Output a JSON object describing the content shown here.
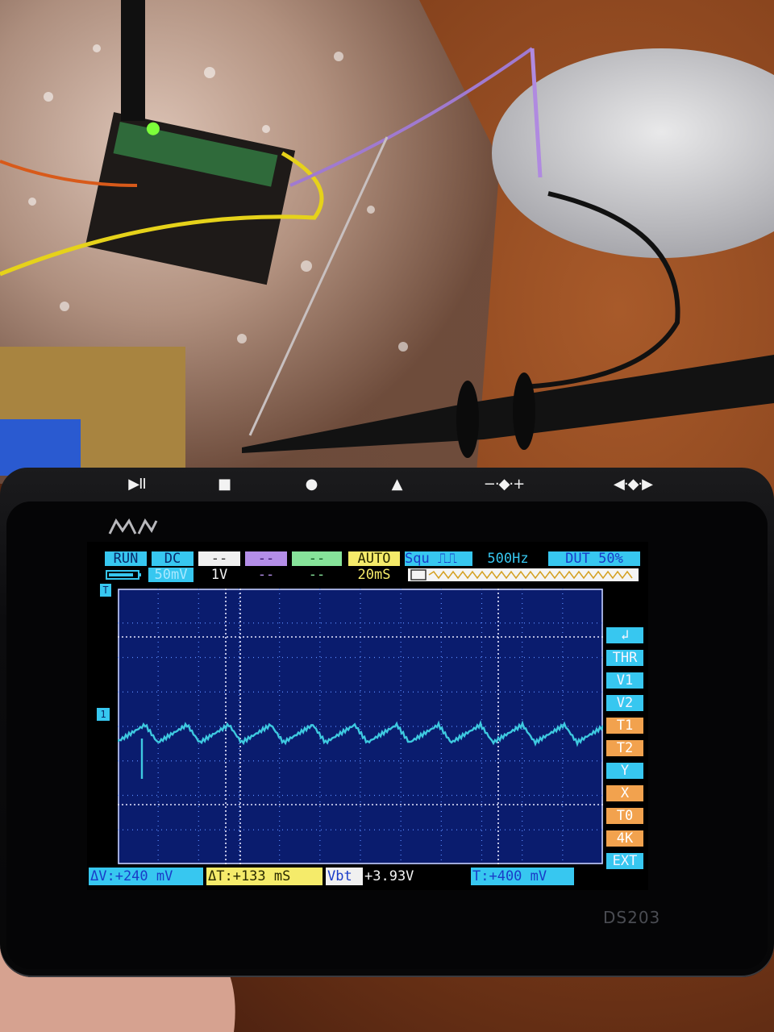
{
  "device": {
    "model": "DS203",
    "logo": "MINI",
    "buttons": [
      "▶II",
      "■",
      "●",
      "▲",
      "−·◆·+",
      "◀·◆·▶"
    ]
  },
  "scope": {
    "header_row1": {
      "run": "RUN",
      "coupling": "DC",
      "ch2": "--",
      "ch3": "--",
      "ch4": "--",
      "trig_mode": "AUTO",
      "wave": "Squ",
      "freq": "500Hz",
      "duty": "DUT 50%"
    },
    "header_row2": {
      "ch1_div": "50mV",
      "ch2_div": "1V",
      "ch3_div": "--",
      "ch4_div": "--",
      "timebase": "20mS"
    },
    "side_menu": [
      "↲",
      "THR",
      "V1",
      "V2",
      "T1",
      "T2",
      "Y",
      "X",
      "T0",
      "4K",
      "EXT"
    ],
    "bottom": {
      "dv": "ΔV:+240 mV",
      "dt": "ΔT:+133 mS",
      "vbt_label": "Vbt",
      "vbt_value": "+3.93V",
      "trig": "T:+400 mV"
    },
    "markers": {
      "t": "T",
      "ch1": "1"
    },
    "colors": {
      "trace": "#3ec9e0",
      "grid_bg": "#0a1c6e",
      "cyan": "#37c7f0",
      "yellow": "#f5eb6a",
      "orange": "#f2a24e"
    }
  }
}
